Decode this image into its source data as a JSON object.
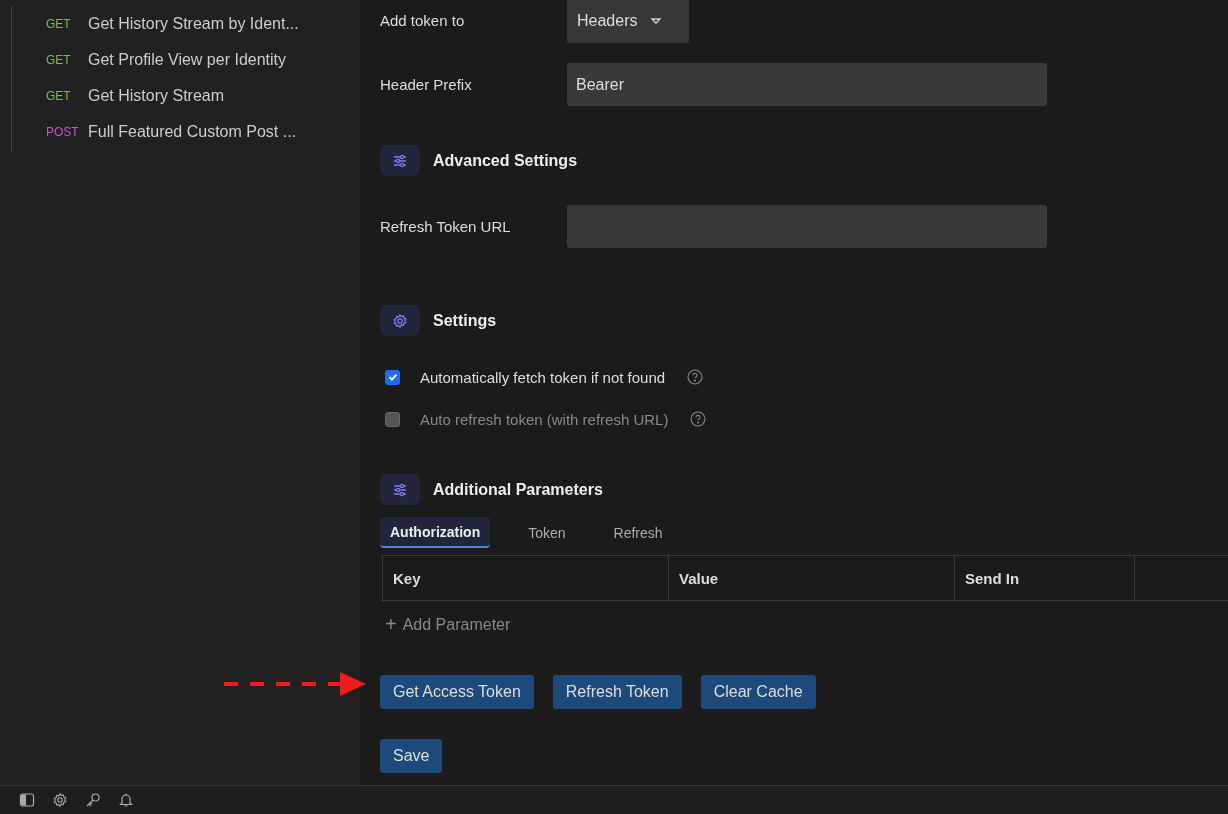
{
  "sidebar": {
    "items": [
      {
        "method": "GET",
        "name": "Get History Stream by Ident..."
      },
      {
        "method": "GET",
        "name": "Get Profile View per Identity"
      },
      {
        "method": "GET",
        "name": "Get History Stream"
      },
      {
        "method": "POST",
        "name": "Full Featured Custom Post ..."
      }
    ]
  },
  "fields": [
    {
      "label": "Add token to",
      "kind": "select",
      "value": "Headers"
    },
    {
      "label": "Header Prefix",
      "kind": "input",
      "value": "Bearer"
    }
  ],
  "advanced": {
    "title": "Advanced Settings",
    "fields": [
      {
        "label": "Refresh Token URL",
        "kind": "input"
      }
    ]
  },
  "settings": {
    "title": "Settings",
    "options": [
      {
        "label": "Automatically fetch token if not found",
        "checked": true,
        "disabled": false
      },
      {
        "label": "Auto refresh token (with refresh URL)",
        "checked": false,
        "disabled": true
      }
    ]
  },
  "additional": {
    "title": "Additional Parameters",
    "tabs": [
      {
        "label": "Authorization",
        "selected": true
      },
      {
        "label": "Token",
        "selected": false
      },
      {
        "label": "Refresh",
        "selected": false
      }
    ],
    "columns": [
      "Key",
      "Value",
      "Send In"
    ],
    "add_label": "Add Parameter",
    "add_icon": "+"
  },
  "actions": [
    "Get Access Token",
    "Refresh Token",
    "Clear Cache"
  ],
  "save": "Save"
}
